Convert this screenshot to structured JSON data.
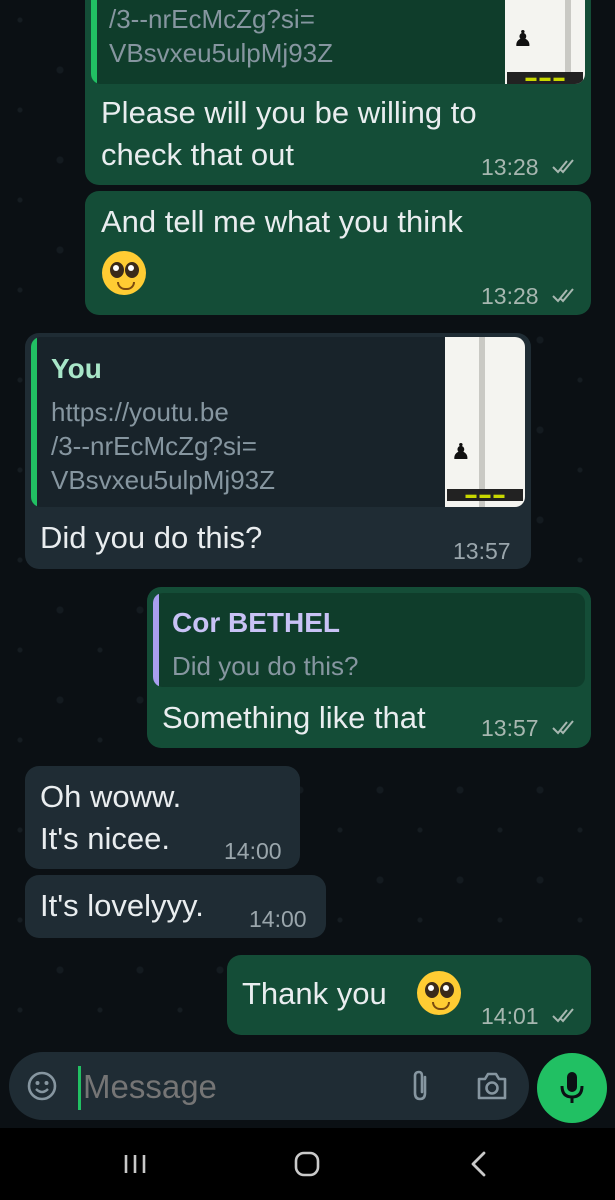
{
  "messages": {
    "m1": {
      "quote_link": "/3--nrEcMcZg?si=\nVBsvxeu5ulpMj93Z",
      "text": "Please will you be willing to\ncheck that out",
      "time": "13:28"
    },
    "m2": {
      "text": "And tell me what you think",
      "time": "13:28"
    },
    "m3": {
      "quote_author": "You",
      "quote_link": "https://youtu.be\n/3--nrEcMcZg?si=\nVBsvxeu5ulpMj93Z",
      "text": "Did you do this?",
      "time": "13:57"
    },
    "m4": {
      "quote_author": "Cor BETHEL",
      "quote_text": "Did you do this?",
      "text": "Something like that",
      "time": "13:57"
    },
    "m5": {
      "text": "Oh woww.\nIt's nicee.",
      "time": "14:00"
    },
    "m6": {
      "text": "It's lovelyyy.",
      "time": "14:00"
    },
    "m7": {
      "text": "Thank you",
      "time": "14:01"
    }
  },
  "composer": {
    "placeholder": "Message"
  },
  "icons": {
    "emoji": "emoji-icon",
    "attach": "paperclip-icon",
    "camera": "camera-icon",
    "mic": "microphone-icon",
    "read_receipt": "double-check-icon",
    "nav_recents": "recents-icon",
    "nav_home": "home-icon",
    "nav_back": "back-icon"
  },
  "colors": {
    "outgoing_bubble": "#144d37",
    "incoming_bubble": "#1f2c34",
    "accent_green": "#21c063",
    "quote_you": "#a8e6c8",
    "quote_other": "#c8c2f5"
  }
}
